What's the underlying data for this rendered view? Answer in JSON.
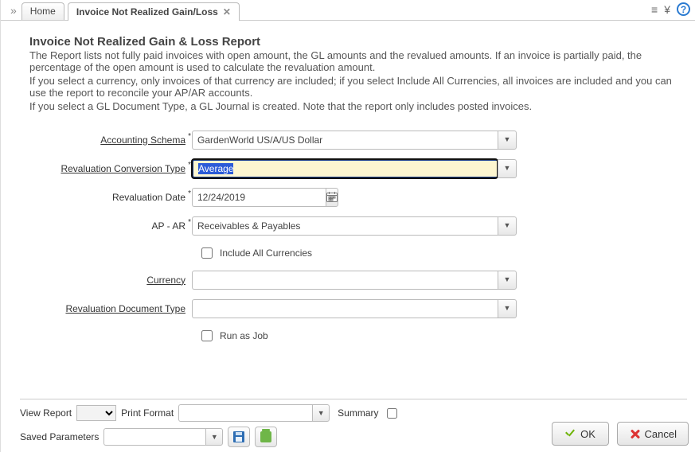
{
  "tabs": {
    "expand_glyph": "»",
    "home": "Home",
    "active": "Invoice Not Realized Gain/Loss",
    "close_glyph": "✕"
  },
  "toolbar_icons": {
    "menu_glyph": "≡",
    "collapse_glyph": "¥",
    "help_glyph": "?"
  },
  "header": {
    "title": "Invoice Not Realized Gain & Loss Report",
    "desc1": "The Report lists not fully paid invoices with open amount, the GL amounts and the revalued amounts. If an invoice is partially paid, the percentage of the open amount is used to calculate the revaluation amount.",
    "desc2": "If you select a currency, only invoices of that currency are included; if you select Include All Currencies, all invoices are included and you can use the report to reconcile your AP/AR accounts.",
    "desc3": "If you select a GL Document Type, a GL Journal is created. Note that the report only includes posted invoices."
  },
  "form": {
    "accounting_schema": {
      "label": "Accounting Schema",
      "value": "GardenWorld US/A/US Dollar"
    },
    "revaluation_conversion_type": {
      "label": "Revaluation Conversion Type",
      "value": "Average"
    },
    "revaluation_date": {
      "label": "Revaluation Date",
      "value": "12/24/2019"
    },
    "ap_ar": {
      "label": "AP - AR",
      "value": "Receivables & Payables"
    },
    "include_all_currencies": {
      "label": "Include All Currencies",
      "checked": false
    },
    "currency": {
      "label": "Currency",
      "value": ""
    },
    "revaluation_document_type": {
      "label": "Revaluation Document Type",
      "value": ""
    },
    "run_as_job": {
      "label": "Run as Job",
      "checked": false
    }
  },
  "bottom": {
    "view_report_label": "View Report",
    "view_report_value": "",
    "print_format_label": "Print Format",
    "print_format_value": "",
    "summary_label": "Summary",
    "summary_checked": false,
    "saved_parameters_label": "Saved Parameters",
    "saved_parameters_value": ""
  },
  "buttons": {
    "ok": "OK",
    "cancel": "Cancel"
  }
}
